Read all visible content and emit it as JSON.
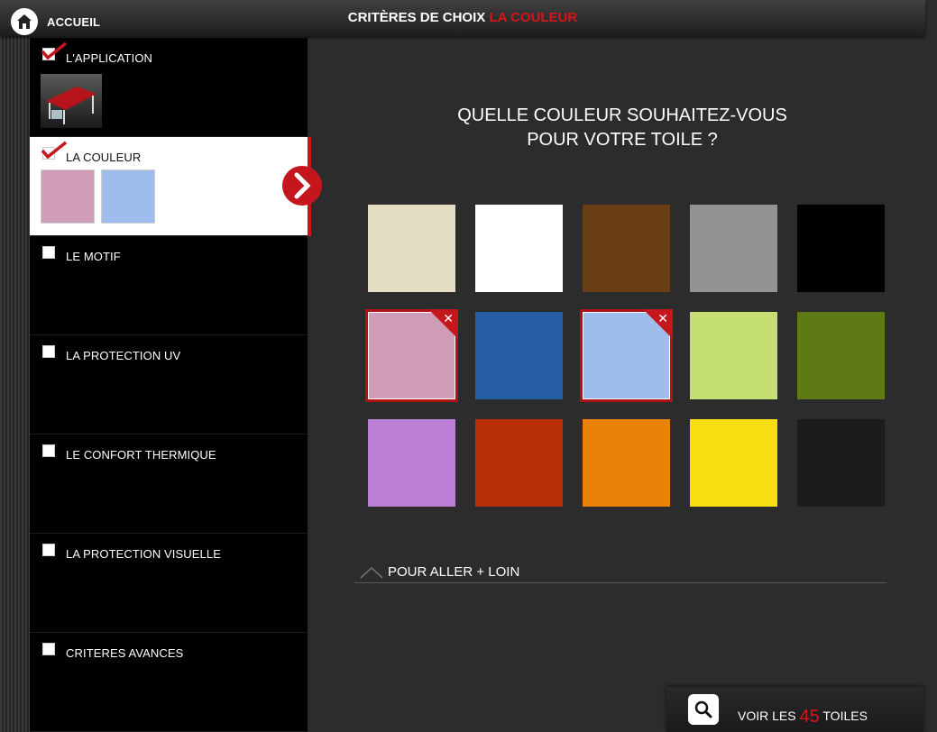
{
  "header": {
    "home_label": "ACCUEIL",
    "title_prefix": "CRITÈRES DE CHOIX",
    "title_accent": "LA COULEUR"
  },
  "sidebar": {
    "steps": [
      {
        "label": "L'APPLICATION",
        "checked": true
      },
      {
        "label": "LA COULEUR",
        "checked": true,
        "active": true
      },
      {
        "label": "LE MOTIF",
        "checked": false
      },
      {
        "label": "LA PROTECTION UV",
        "checked": false
      },
      {
        "label": "LE CONFORT THERMIQUE",
        "checked": false
      },
      {
        "label": "LA PROTECTION VISUELLE",
        "checked": false
      },
      {
        "label": "CRITERES AVANCES",
        "checked": false
      }
    ],
    "selected_colors": [
      "#cf9db8",
      "#9fbdec"
    ]
  },
  "main": {
    "question_line1": "QUELLE COULEUR SOUHAITEZ-VOUS",
    "question_line2": "POUR VOTRE TOILE ?",
    "colors": [
      {
        "hex": "#e3dec3",
        "selected": false
      },
      {
        "hex": "#ffffff",
        "selected": false
      },
      {
        "hex": "#6a3e15",
        "selected": false
      },
      {
        "hex": "#939393",
        "selected": false
      },
      {
        "hex": "#000000",
        "selected": false
      },
      {
        "hex": "#cf9db8",
        "selected": true
      },
      {
        "hex": "#255ea3",
        "selected": false
      },
      {
        "hex": "#9fbdec",
        "selected": true
      },
      {
        "hex": "#c6df72",
        "selected": false
      },
      {
        "hex": "#5f7914",
        "selected": false
      },
      {
        "hex": "#bb7fd6",
        "selected": false
      },
      {
        "hex": "#b82e08",
        "selected": false
      },
      {
        "hex": "#e98207",
        "selected": false
      },
      {
        "hex": "#f8df14",
        "selected": false
      },
      {
        "hex": "#1c1c1c",
        "selected": false
      }
    ],
    "more_label": "POUR ALLER + LOIN"
  },
  "footer": {
    "results_prefix": "VOIR LES",
    "results_count": "45",
    "results_suffix": "TOILES"
  },
  "theme": {
    "accent": "#d8141b"
  }
}
